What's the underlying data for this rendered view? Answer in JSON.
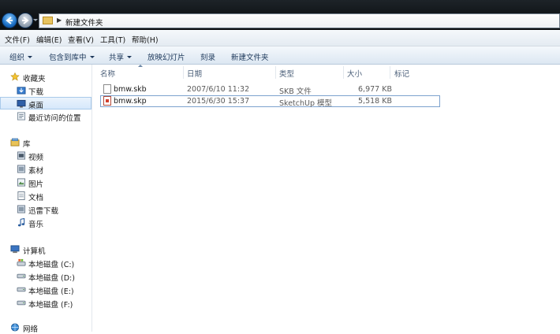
{
  "address": {
    "path": "新建文件夹"
  },
  "menu": [
    "文件(F)",
    "编辑(E)",
    "查看(V)",
    "工具(T)",
    "帮助(H)"
  ],
  "commands": [
    {
      "label": "组织",
      "dropdown": true
    },
    {
      "label": "包含到库中",
      "dropdown": true
    },
    {
      "label": "共享",
      "dropdown": true
    },
    {
      "label": "放映幻灯片",
      "dropdown": false
    },
    {
      "label": "刻录",
      "dropdown": false
    },
    {
      "label": "新建文件夹",
      "dropdown": false
    }
  ],
  "nav": {
    "favorites": {
      "label": "收藏夹",
      "items": [
        "下载",
        "桌面",
        "最近访问的位置"
      ],
      "selected": "桌面"
    },
    "libraries": {
      "label": "库",
      "items": [
        "视频",
        "素材",
        "图片",
        "文档",
        "迅雷下载",
        "音乐"
      ]
    },
    "computer": {
      "label": "计算机",
      "items": [
        "本地磁盘 (C:)",
        "本地磁盘 (D:)",
        "本地磁盘 (E:)",
        "本地磁盘 (F:)"
      ]
    },
    "network": {
      "label": "网络"
    }
  },
  "columns": {
    "name": "名称",
    "date": "日期",
    "type": "类型",
    "size": "大小",
    "tags": "标记"
  },
  "files": [
    {
      "name": "bmw.skb",
      "date": "2007/6/10 11:32",
      "type": "SKB 文件",
      "size": "6,977 KB",
      "icon": "generic-file-icon"
    },
    {
      "name": "bmw.skp",
      "date": "2015/6/30 15:37",
      "type": "SketchUp 模型",
      "size": "5,518 KB",
      "icon": "sketchup-file-icon",
      "selected": true
    }
  ]
}
